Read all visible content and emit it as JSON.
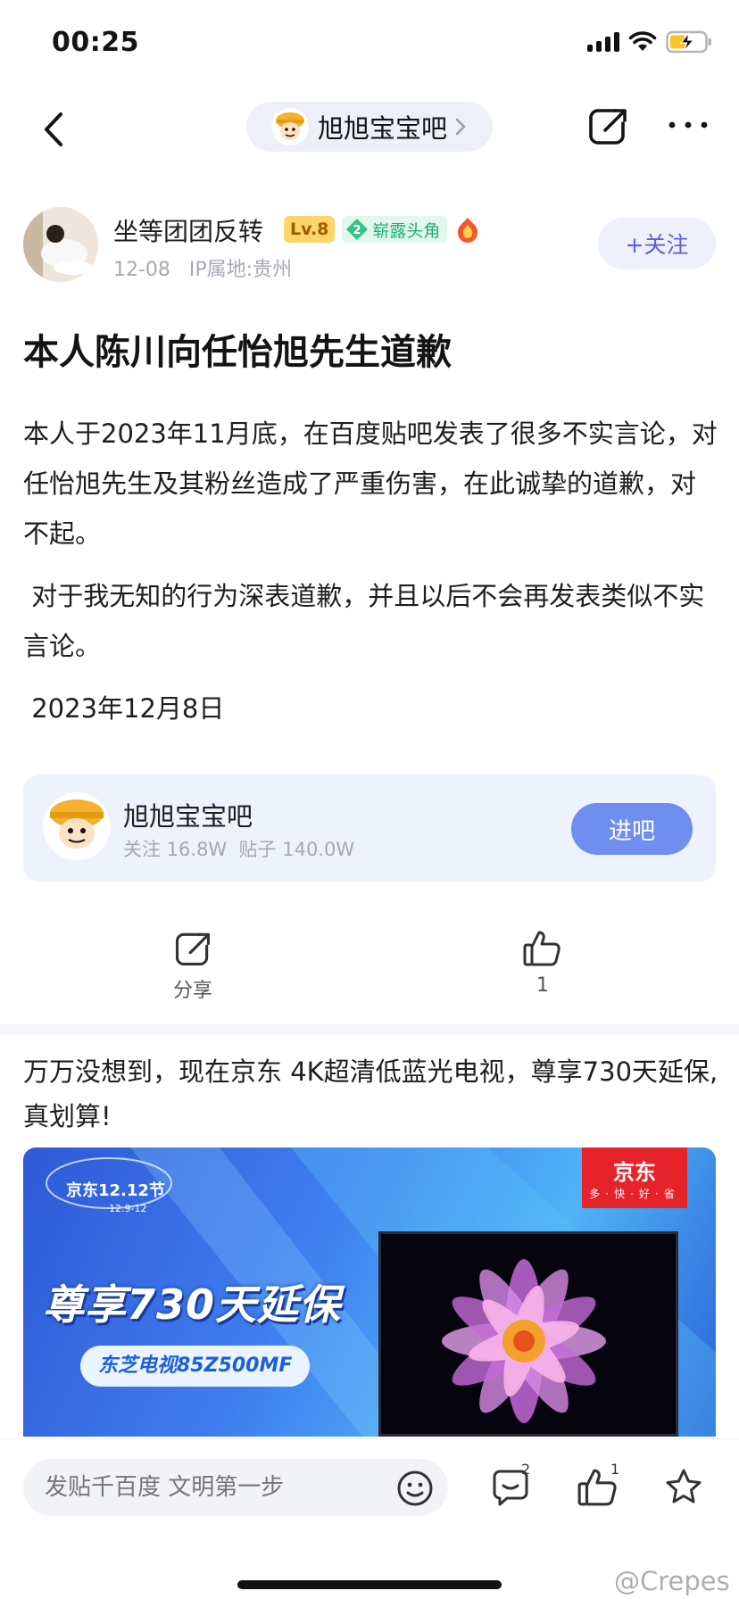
{
  "status_bar": {
    "time": "00:25"
  },
  "nav": {
    "forum_name": "旭旭宝宝吧"
  },
  "author": {
    "name": "坐等团团反转",
    "level": "Lv.8",
    "title_num": "2",
    "title": "崭露头角",
    "date": "12-08",
    "ip": "IP属地:贵州",
    "follow_label": "+关注"
  },
  "post": {
    "title": "本人陈川向任怡旭先生道歉",
    "paragraphs": [
      "本人于2023年11月底，在百度贴吧发表了很多不实言论，对任怡旭先生及其粉丝造成了严重伤害，在此诚挚的道歉，对不起。",
      " 对于我无知的行为深表道歉，并且以后不会再发表类似不实言论。",
      " 2023年12月8日"
    ]
  },
  "forum_card": {
    "name": "旭旭宝宝吧",
    "stats": "关注 16.8W  贴子 140.0W",
    "enter_label": "进吧"
  },
  "actions": {
    "share_label": "分享",
    "like_count": "1"
  },
  "ad": {
    "text": "万万没想到，现在京东 4K超清低蓝光电视，尊享730天延保,真划算!",
    "event": "京东12.12节",
    "event_dates": "12.9-12",
    "brand": "京东",
    "brand_slogan": "多·快·好·省",
    "headline": "尊享730天延保",
    "model": "东芝电视85Z500MF"
  },
  "bottom_bar": {
    "placeholder": "发贴千百度 文明第一步",
    "comment_count": "2",
    "like_count": "1"
  },
  "watermark": "@Crepes"
}
